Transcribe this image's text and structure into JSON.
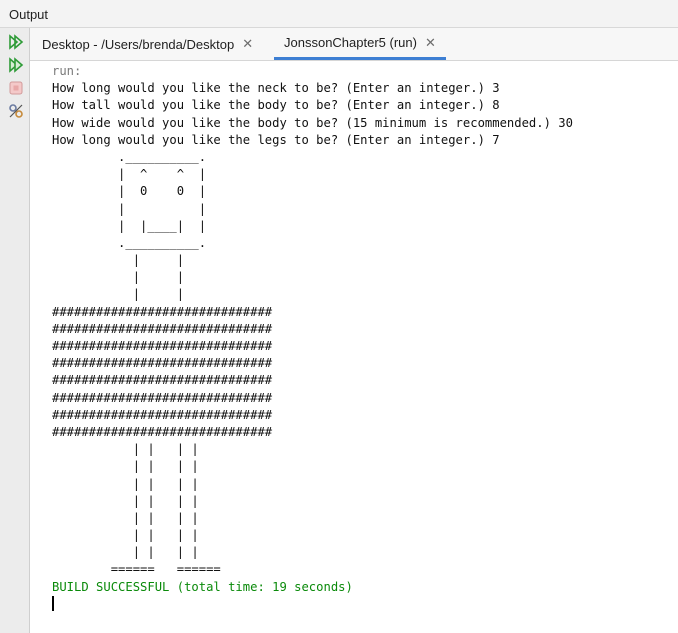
{
  "window": {
    "title": "Output"
  },
  "toolbar": {
    "buttons": [
      "rerun-icon",
      "rerun-with-options-icon",
      "stop-icon",
      "settings-icon"
    ],
    "accent_green": "#2e9b37"
  },
  "tabs": [
    {
      "label": "Desktop - /Users/brenda/Desktop",
      "active": false
    },
    {
      "label": "JonssonChapter5 (run)",
      "active": true
    }
  ],
  "console": {
    "run_label": "run:",
    "prompts": [
      "How long would you like the neck to be? (Enter an integer.) 3",
      "How tall would you like the body to be? (Enter an integer.) 8",
      "How wide would you like the body to be? (15 minimum is recommended.) 30",
      "How long would you like the legs to be? (Enter an integer.) 7"
    ],
    "art_lines": [
      "         .__________.",
      "         |  ^    ^  |",
      "         |  0    0  |",
      "         |          |",
      "         |  |____|  |",
      "         .__________.",
      "           |     |",
      "           |     |",
      "           |     |",
      "##############################",
      "##############################",
      "##############################",
      "##############################",
      "##############################",
      "##############################",
      "##############################",
      "##############################",
      "           | |   | |",
      "           | |   | |",
      "           | |   | |",
      "           | |   | |",
      "           | |   | |",
      "           | |   | |",
      "           | |   | |",
      "        ======   ======"
    ],
    "build_status": "BUILD SUCCESSFUL (total time: 19 seconds)",
    "success_color": "#0a8a0a"
  }
}
